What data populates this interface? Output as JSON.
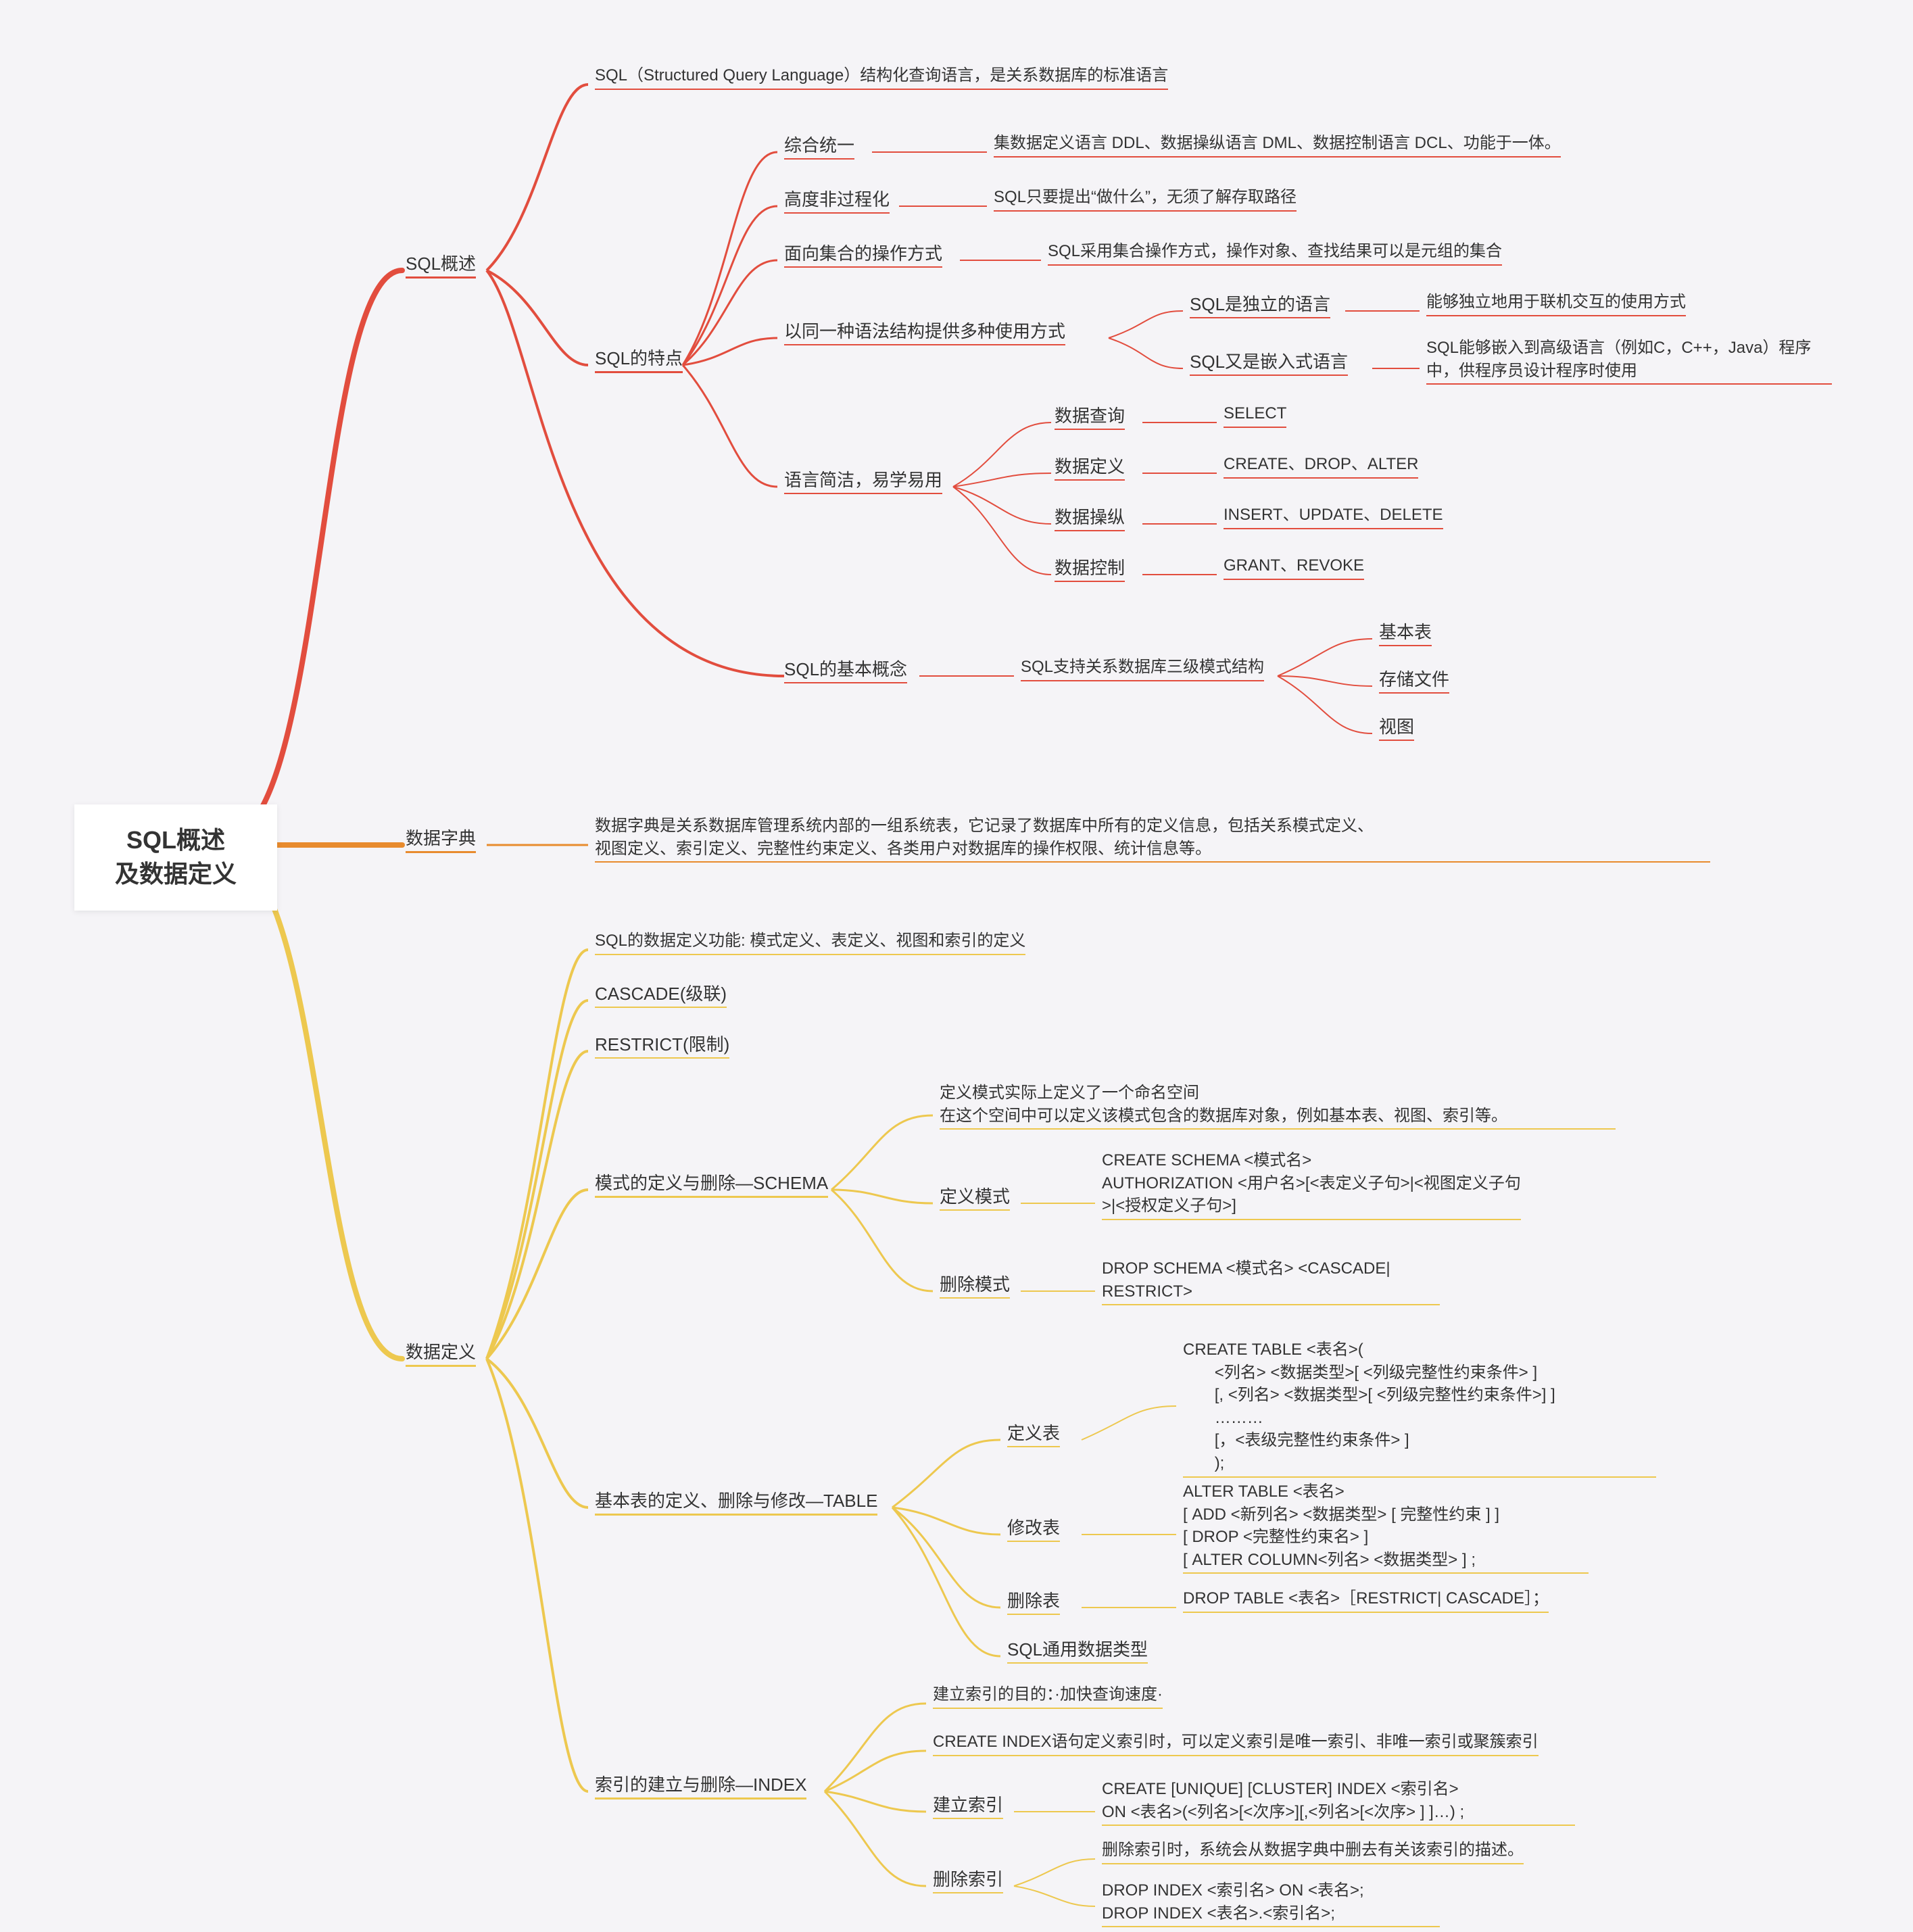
{
  "root": "SQL概述\n及数据定义",
  "b1": {
    "label": "SQL概述",
    "n1": "SQL（Structured Query Language）结构化查询语言，是关系数据库的标准语言",
    "n2": {
      "label": "SQL的特点",
      "a": {
        "label": "综合统一",
        "desc": "集数据定义语言 DDL、数据操纵语言 DML、数据控制语言 DCL、功能于一体。"
      },
      "b": {
        "label": "高度非过程化",
        "desc": "SQL只要提出“做什么”，无须了解存取路径"
      },
      "c": {
        "label": "面向集合的操作方式",
        "desc": "SQL采用集合操作方式，操作对象、查找结果可以是元组的集合"
      },
      "d": {
        "label": "以同一种语法结构提供多种使用方式",
        "d1": {
          "label": "SQL是独立的语言",
          "desc": "能够独立地用于联机交互的使用方式"
        },
        "d2": {
          "label": "SQL又是嵌入式语言",
          "desc": "SQL能够嵌入到高级语言（例如C，C++，Java）程序中，供程序员设计程序时使用"
        }
      },
      "e": {
        "label": "语言简洁，易学易用",
        "q": {
          "label": "数据查询",
          "desc": "SELECT"
        },
        "df": {
          "label": "数据定义",
          "desc": "CREATE、DROP、ALTER"
        },
        "dm": {
          "label": "数据操纵",
          "desc": "INSERT、UPDATE、DELETE"
        },
        "dc": {
          "label": "数据控制",
          "desc": "GRANT、REVOKE"
        }
      }
    },
    "n3": {
      "label": "SQL的基本概念",
      "desc": "SQL支持关系数据库三级模式结构",
      "items": [
        "基本表",
        "存储文件",
        "视图"
      ]
    }
  },
  "b2": {
    "label": "数据字典",
    "desc": "数据字典是关系数据库管理系统内部的一组系统表，它记录了数据库中所有的定义信息，包括关系模式定义、\n视图定义、索引定义、完整性约束定义、各类用户对数据库的操作权限、统计信息等。"
  },
  "b3": {
    "label": "数据定义",
    "n1": "SQL的数据定义功能: 模式定义、表定义、视图和索引的定义",
    "n2": "CASCADE(级联)",
    "n3": "RESTRICT(限制)",
    "schema": {
      "label": "模式的定义与删除—SCHEMA",
      "ns": "定义模式实际上定义了一个命名空间\n在这个空间中可以定义该模式包含的数据库对象，例如基本表、视图、索引等。",
      "create": {
        "label": "定义模式",
        "desc": "CREATE SCHEMA <模式名>\nAUTHORIZATION <用户名>[<表定义子句>|<视图定义子句>|<授权定义子句>]"
      },
      "drop": {
        "label": "删除模式",
        "desc": "DROP SCHEMA <模式名> <CASCADE|\nRESTRICT>"
      }
    },
    "table": {
      "label": "基本表的定义、删除与修改—TABLE",
      "create": {
        "label": "定义表",
        "desc": "CREATE TABLE <表名>(\n       <列名> <数据类型>[ <列级完整性约束条件> ]\n       [, <列名> <数据类型>[ <列级完整性约束条件>] ]\n       ………\n       [，<表级完整性约束条件> ]\n       );"
      },
      "alter": {
        "label": "修改表",
        "desc": "ALTER TABLE <表名>\n[ ADD <新列名> <数据类型> [ 完整性约束 ] ]\n[ DROP <完整性约束名> ]\n[ ALTER COLUMN<列名> <数据类型> ] ;"
      },
      "drop": {
        "label": "删除表",
        "desc": "DROP TABLE <表名>［RESTRICT| CASCADE］；"
      },
      "types": "SQL通用数据类型"
    },
    "index": {
      "label": "索引的建立与删除—INDEX",
      "purpose": "建立索引的目的：·加快查询速度·",
      "note": "CREATE INDEX语句定义索引时，可以定义索引是唯一索引、非唯一索引或聚簇索引",
      "create": {
        "label": "建立索引",
        "desc": "CREATE [UNIQUE] [CLUSTER] INDEX <索引名>\nON <表名>(<列名>[<次序>][,<列名>[<次序> ] ]…) ;"
      },
      "drop": {
        "label": "删除索引",
        "desc1": "删除索引时，系统会从数据字典中删去有关该索引的描述。",
        "desc2": "DROP INDEX <索引名> ON <表名>;\nDROP INDEX <表名>.<索引名>;"
      }
    }
  }
}
